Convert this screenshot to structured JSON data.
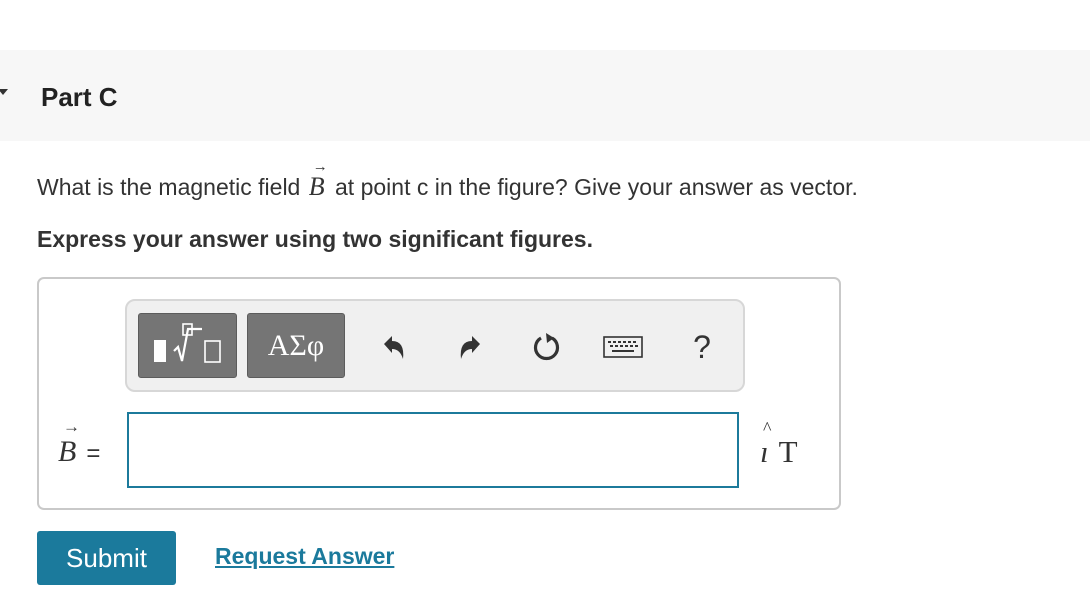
{
  "part": {
    "title": "Part C"
  },
  "question": {
    "text_before": "What is the magnetic field",
    "vector_symbol": "B",
    "vector_arrow": "→",
    "text_after": "at point c in the figure? Give your answer as vector."
  },
  "instruction": "Express your answer using two significant figures.",
  "toolbar": {
    "symbols_label": "ΑΣφ",
    "help_label": "?",
    "icons": [
      "templates-icon",
      "undo-icon",
      "redo-icon",
      "reset-icon",
      "keyboard-icon",
      "help-icon"
    ]
  },
  "answer": {
    "lhs_symbol": "B",
    "lhs_arrow": "→",
    "equals": "=",
    "value": "",
    "unit_vector": "ı",
    "unit_hat": "^",
    "unit": "T"
  },
  "actions": {
    "submit_label": "Submit",
    "request_label": "Request Answer"
  },
  "colors": {
    "accent": "#1b7a9c",
    "toolbar_button": "#757575",
    "header_bg": "#f7f7f7"
  }
}
